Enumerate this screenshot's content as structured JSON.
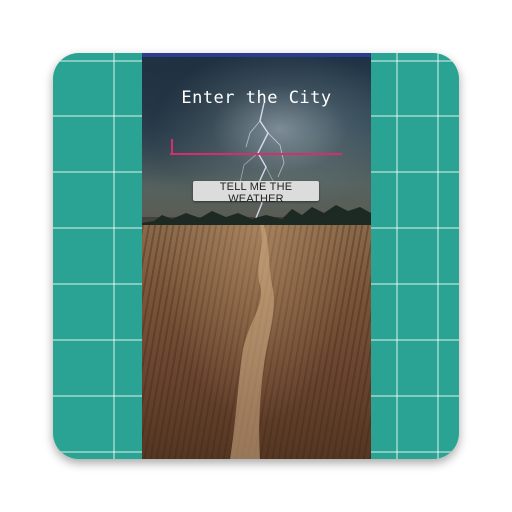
{
  "app": {
    "icon_background_color": "#2aa394",
    "status_bar_color": "#2b3d8f",
    "accent_color": "#d0306e"
  },
  "screen": {
    "title": "Enter the City",
    "city_input": {
      "value": "",
      "placeholder": ""
    },
    "weather_button_label": "TELL ME THE WEATHER",
    "background_image": "stormy-sky-lightning-field-path"
  }
}
